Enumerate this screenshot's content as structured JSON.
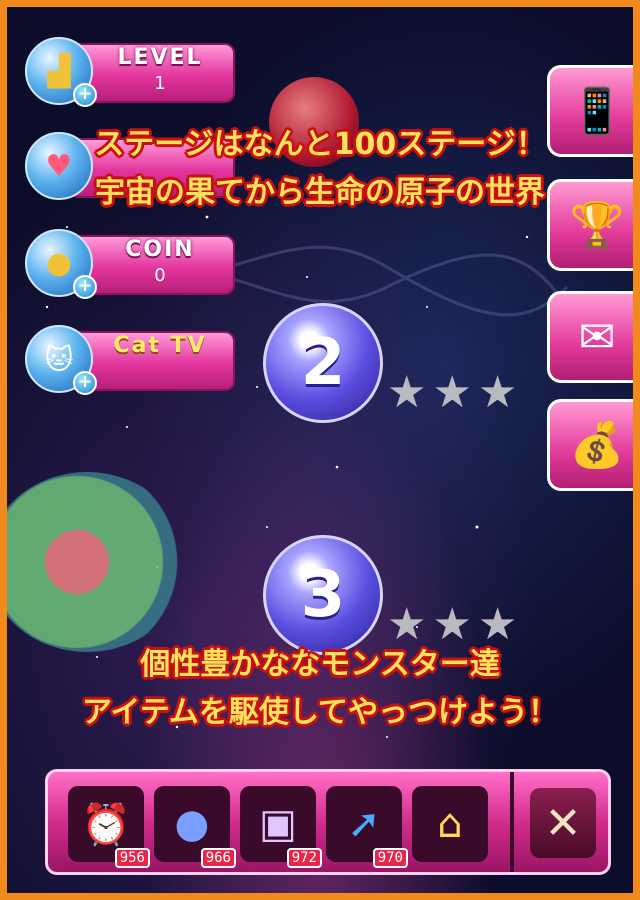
{
  "hud": {
    "level": {
      "label": "LEVEL",
      "value": "1"
    },
    "coin": {
      "label": "COIN",
      "value": "0"
    },
    "cattv": {
      "label": "Cat TV"
    }
  },
  "side_buttons": [
    "apps-button",
    "trophy-button",
    "mail-button",
    "treasure-button"
  ],
  "stages": [
    {
      "number": "2",
      "stars": 0
    },
    {
      "number": "3",
      "stars": 0
    }
  ],
  "promo": {
    "top_line1": "ステージはなんと100ステージ！",
    "top_line2": "宇宙の果てから生命の原子の世界",
    "bottom_line1": "個性豊かななモンスター達",
    "bottom_line2": "アイテムを駆使してやっつけよう！"
  },
  "items": [
    {
      "icon": "alarm-clock-icon",
      "count": "956"
    },
    {
      "icon": "bomb-icon",
      "count": "966"
    },
    {
      "icon": "frame-icon",
      "count": "972"
    },
    {
      "icon": "arrow-icon",
      "count": "970"
    },
    {
      "icon": "shop-icon",
      "count": ""
    }
  ],
  "close_label": "✕"
}
